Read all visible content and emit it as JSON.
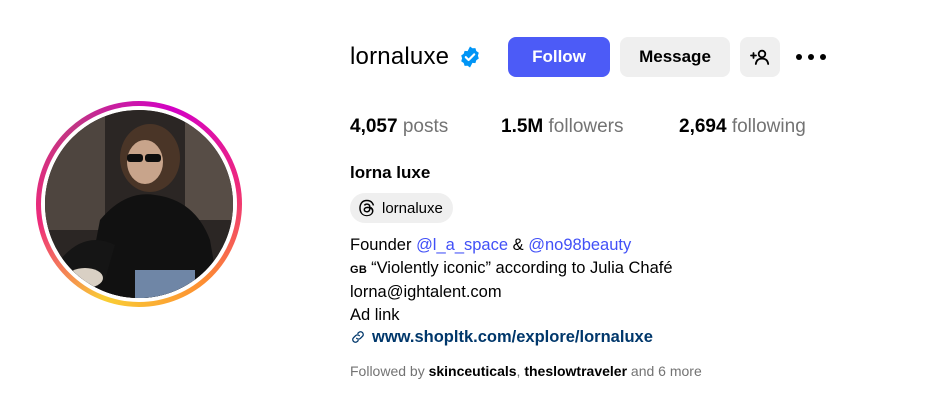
{
  "profile": {
    "username": "lornaluxe",
    "verified": true,
    "full_name": "lorna luxe",
    "threads_handle": "lornaluxe",
    "avatar_icon": "profile-photo"
  },
  "actions": {
    "follow_label": "Follow",
    "message_label": "Message",
    "add_user_icon": "person-add-icon",
    "more_icon": "more-horizontal-icon",
    "follow_color": "#4c5bf7"
  },
  "stats": {
    "posts_count": "4,057",
    "posts_label": "posts",
    "followers_count": "1.5M",
    "followers_label": "followers",
    "following_count": "2,694",
    "following_label": "following"
  },
  "bio": {
    "line1_prefix": "Founder",
    "mention1": "@l_a_space",
    "ampersand": "&",
    "mention2": "@no98beauty",
    "line2_flag": "GB",
    "line2_text": "“Violently iconic” according to Julia Chafé",
    "line3": "lorna@ightalent.com",
    "line4": "Ad link",
    "link": "www.shopltk.com/explore/lornaluxe"
  },
  "followed_by": {
    "prefix": "Followed by",
    "user1": "skinceuticals",
    "separator": ",",
    "user2": "theslowtraveler",
    "suffix": "and 6 more"
  }
}
